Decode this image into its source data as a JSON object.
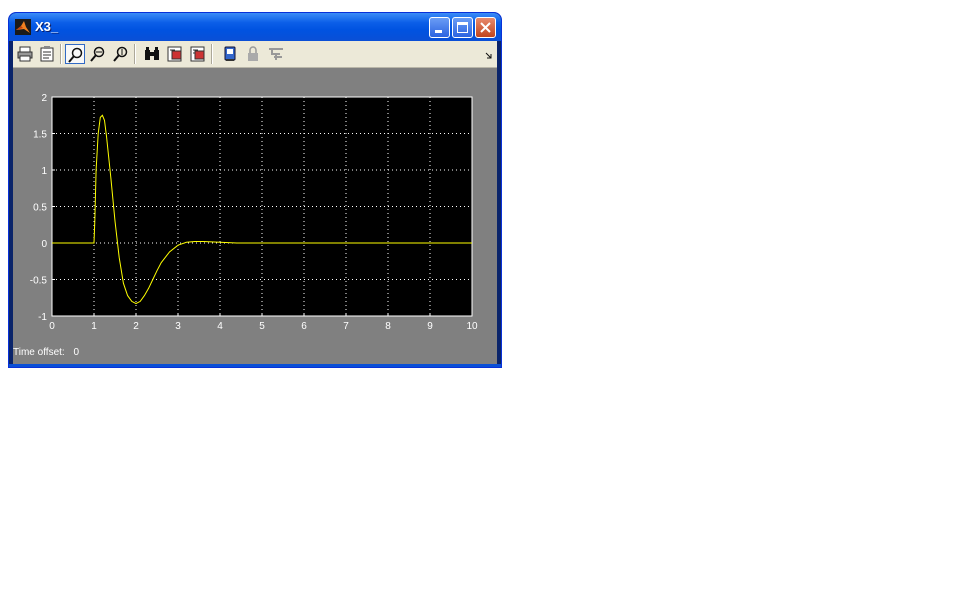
{
  "window": {
    "title": "X3_"
  },
  "toolbar": {
    "tools": [
      {
        "icon": "print-icon"
      },
      {
        "icon": "parameters-icon"
      },
      {
        "icon": "zoom-icon"
      },
      {
        "icon": "zoom-x-icon"
      },
      {
        "icon": "zoom-y-icon"
      },
      {
        "icon": "autoscale-icon"
      },
      {
        "icon": "save-axes-icon"
      },
      {
        "icon": "restore-axes-icon"
      },
      {
        "icon": "floating-scope-icon"
      },
      {
        "icon": "lock-icon"
      },
      {
        "icon": "signal-selection-icon"
      }
    ],
    "overflow_icon": "chevron-icon"
  },
  "status": {
    "offset_label": "Time offset:",
    "offset_value": "0"
  },
  "chart_data": {
    "type": "line",
    "title": "",
    "xlabel": "",
    "ylabel": "",
    "xlim": [
      0,
      10
    ],
    "ylim": [
      -1,
      2
    ],
    "xticks": [
      "0",
      "1",
      "2",
      "3",
      "4",
      "5",
      "6",
      "7",
      "8",
      "9",
      "10"
    ],
    "yticks": [
      "2",
      "1.5",
      "1",
      "0.5",
      "0",
      "-0.5",
      "-1"
    ],
    "grid": true,
    "background": "#000000",
    "line_color": "#ffff00",
    "series": [
      {
        "x": [
          0,
          1.0,
          1.02,
          1.05,
          1.1,
          1.15,
          1.2,
          1.25,
          1.3,
          1.4,
          1.5,
          1.6,
          1.7,
          1.8,
          1.9,
          2.0,
          2.1,
          2.2,
          2.3,
          2.4,
          2.5,
          2.6,
          2.8,
          3.0,
          3.2,
          3.4,
          3.6,
          3.8,
          4.0,
          4.2,
          4.4,
          10
        ],
        "y": [
          0,
          0,
          0.3,
          1.0,
          1.5,
          1.72,
          1.75,
          1.68,
          1.45,
          0.9,
          0.3,
          -0.2,
          -0.55,
          -0.72,
          -0.8,
          -0.83,
          -0.8,
          -0.72,
          -0.62,
          -0.5,
          -0.38,
          -0.27,
          -0.12,
          -0.03,
          0.01,
          0.02,
          0.02,
          0.015,
          0.01,
          0.005,
          0,
          0
        ]
      }
    ]
  }
}
